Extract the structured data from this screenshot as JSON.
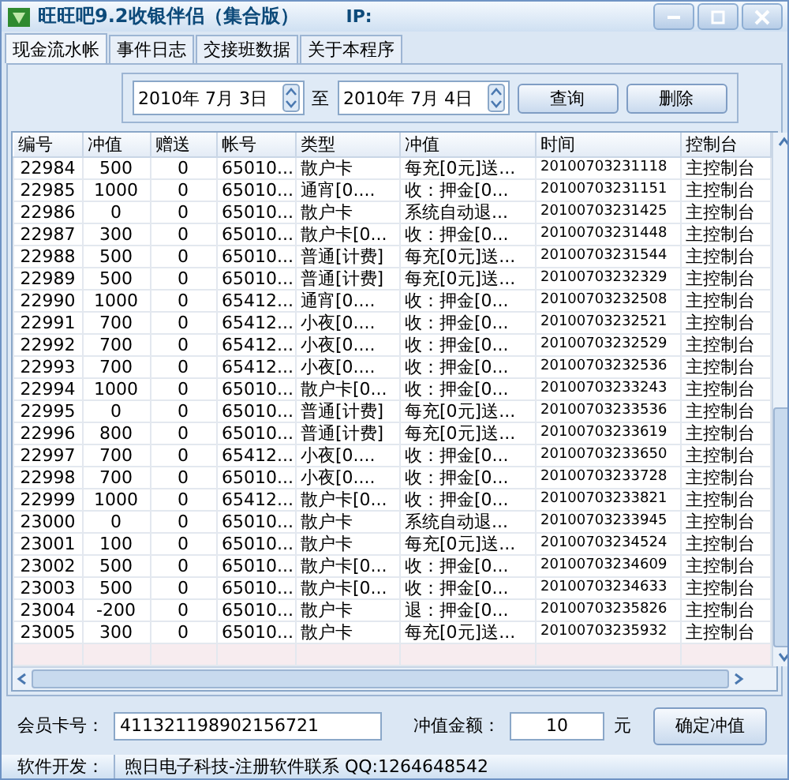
{
  "window": {
    "title": "旺旺吧9.2收银伴侣（集合版）",
    "ip_label": "IP:"
  },
  "tabs": [
    {
      "label": "现金流水帐",
      "selected": true
    },
    {
      "label": "事件日志",
      "selected": false
    },
    {
      "label": "交接班数据",
      "selected": false
    },
    {
      "label": "关于本程序",
      "selected": false
    }
  ],
  "query": {
    "from_date": "2010年 7月 3日",
    "separator": "至",
    "to_date": "2010年 7月 4日",
    "query_button": "查询",
    "delete_button": "删除"
  },
  "table": {
    "columns": [
      "编号",
      "冲值",
      "赠送",
      "帐号",
      "类型",
      "冲值",
      "时间",
      "控制台"
    ],
    "rows": [
      [
        "22984",
        "500",
        "0",
        "65010...",
        "散户卡",
        "每充[0元]送...",
        "20100703231118",
        "主控制台"
      ],
      [
        "22985",
        "1000",
        "0",
        "65010...",
        "通宵[0....",
        "收：押金[0...",
        "20100703231151",
        "主控制台"
      ],
      [
        "22986",
        "0",
        "0",
        "65010...",
        "散户卡",
        "系统自动退...",
        "20100703231425",
        "主控制台"
      ],
      [
        "22987",
        "300",
        "0",
        "65010...",
        "散户卡[0...",
        "收：押金[0...",
        "20100703231448",
        "主控制台"
      ],
      [
        "22988",
        "500",
        "0",
        "65010...",
        "普通[计费]",
        "每充[0元]送...",
        "20100703231544",
        "主控制台"
      ],
      [
        "22989",
        "500",
        "0",
        "65010...",
        "普通[计费]",
        "每充[0元]送...",
        "20100703232329",
        "主控制台"
      ],
      [
        "22990",
        "1000",
        "0",
        "65412...",
        "通宵[0....",
        "收：押金[0...",
        "20100703232508",
        "主控制台"
      ],
      [
        "22991",
        "700",
        "0",
        "65412...",
        "小夜[0....",
        "收：押金[0...",
        "20100703232521",
        "主控制台"
      ],
      [
        "22992",
        "700",
        "0",
        "65412...",
        "小夜[0....",
        "收：押金[0...",
        "20100703232529",
        "主控制台"
      ],
      [
        "22993",
        "700",
        "0",
        "65412...",
        "小夜[0....",
        "收：押金[0...",
        "20100703232536",
        "主控制台"
      ],
      [
        "22994",
        "1000",
        "0",
        "65010...",
        "散户卡[0...",
        "收：押金[0...",
        "20100703233243",
        "主控制台"
      ],
      [
        "22995",
        "0",
        "0",
        "65010...",
        "普通[计费]",
        "每充[0元]送...",
        "20100703233536",
        "主控制台"
      ],
      [
        "22996",
        "800",
        "0",
        "65010...",
        "普通[计费]",
        "每充[0元]送...",
        "20100703233619",
        "主控制台"
      ],
      [
        "22997",
        "700",
        "0",
        "65412...",
        "小夜[0....",
        "收：押金[0...",
        "20100703233650",
        "主控制台"
      ],
      [
        "22998",
        "700",
        "0",
        "65010...",
        "小夜[0....",
        "收：押金[0...",
        "20100703233728",
        "主控制台"
      ],
      [
        "22999",
        "1000",
        "0",
        "65412...",
        "散户卡[0...",
        "收：押金[0...",
        "20100703233821",
        "主控制台"
      ],
      [
        "23000",
        "0",
        "0",
        "65010...",
        "散户卡",
        "系统自动退...",
        "20100703233945",
        "主控制台"
      ],
      [
        "23001",
        "100",
        "0",
        "65010...",
        "散户卡",
        "每充[0元]送...",
        "20100703234524",
        "主控制台"
      ],
      [
        "23002",
        "500",
        "0",
        "65010...",
        "散户卡[0...",
        "收：押金[0...",
        "20100703234609",
        "主控制台"
      ],
      [
        "23003",
        "500",
        "0",
        "65010...",
        "散户卡[0...",
        "收：押金[0...",
        "20100703234633",
        "主控制台"
      ],
      [
        "23004",
        "-200",
        "0",
        "65010...",
        "散户卡",
        "退：押金[0...",
        "20100703235826",
        "主控制台"
      ],
      [
        "23005",
        "300",
        "0",
        "65010...",
        "散户卡",
        "每充[0元]送...",
        "20100703235932",
        "主控制台"
      ]
    ]
  },
  "recharge": {
    "card_label": "会员卡号：",
    "card_value": "411321198902156721",
    "amount_label": "冲值金额：",
    "amount_value": "10",
    "unit": "元",
    "confirm_button": "确定冲值"
  },
  "status_bar": {
    "label": "软件开发：",
    "text": "煦日电子科技-注册软件联系 QQ:1264648542"
  }
}
